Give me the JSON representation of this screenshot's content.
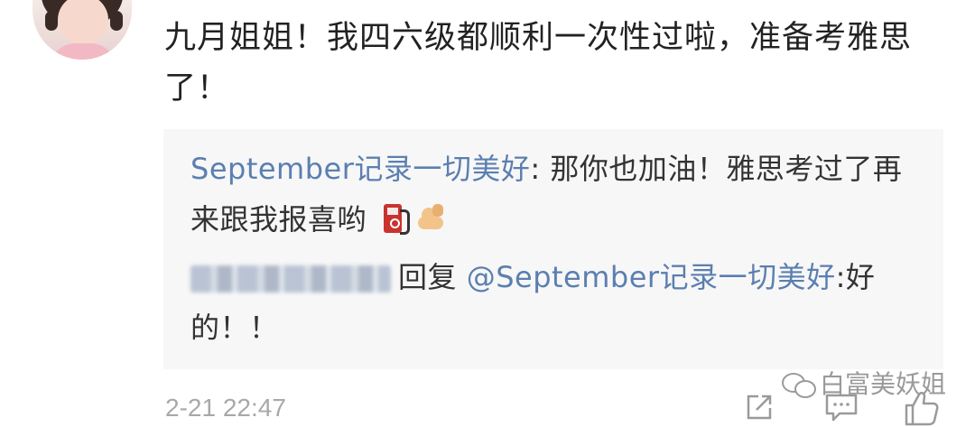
{
  "comment": {
    "text": "九月姐姐！我四六级都顺利一次性过啦，准备考雅思了！"
  },
  "reply": {
    "author_name": "September记录一切美好",
    "author_text": ": 那你也加油！雅思考过了再来跟我报喜哟",
    "emoji_1": "fuel-pump-icon",
    "emoji_2": "flexed-biceps-icon",
    "reply_label": "回复",
    "mention": "@September记录一切美好",
    "reply_text": ":好的！！"
  },
  "meta": {
    "timestamp": "2-21 22:47"
  },
  "watermark": {
    "text": "白富美妖姐"
  }
}
